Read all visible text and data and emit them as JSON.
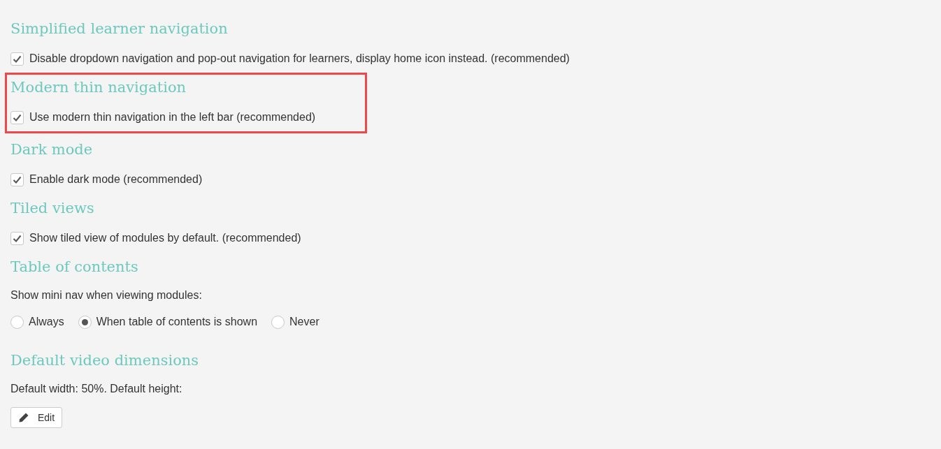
{
  "sections": [
    {
      "kind": "checkbox",
      "title": "Simplified learner navigation",
      "highlighted": false,
      "checkbox": {
        "label": "Disable dropdown navigation and pop-out navigation for learners, display home icon instead. (recommended)",
        "checked": true
      }
    },
    {
      "kind": "checkbox",
      "title": "Modern thin navigation",
      "highlighted": true,
      "checkbox": {
        "label": "Use modern thin navigation in the left bar (recommended)",
        "checked": true
      }
    },
    {
      "kind": "checkbox",
      "title": "Dark mode",
      "highlighted": false,
      "checkbox": {
        "label": "Enable dark mode (recommended)",
        "checked": true
      }
    },
    {
      "kind": "checkbox",
      "title": "Tiled views",
      "highlighted": false,
      "checkbox": {
        "label": "Show tiled view of modules by default. (recommended)",
        "checked": true
      }
    },
    {
      "kind": "radio",
      "title": "Table of contents",
      "highlighted": false,
      "description": "Show mini nav when viewing modules:",
      "options": [
        {
          "label": "Always",
          "selected": false
        },
        {
          "label": "When table of contents is shown",
          "selected": true
        },
        {
          "label": "Never",
          "selected": false
        }
      ]
    },
    {
      "kind": "edit",
      "title": "Default video dimensions",
      "highlighted": false,
      "description": "Default width: 50%. Default height:",
      "button": "Edit"
    }
  ]
}
